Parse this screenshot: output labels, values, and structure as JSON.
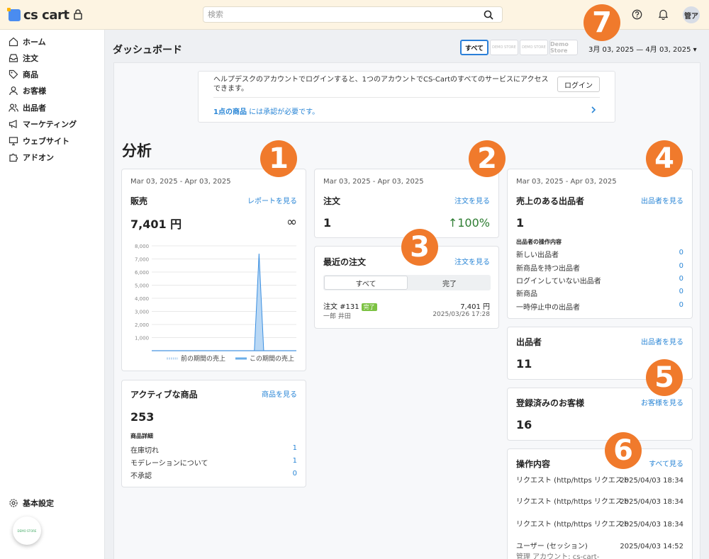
{
  "topbar": {
    "logo_text": "cs cart",
    "search_placeholder": "検索",
    "avatar": "管ア"
  },
  "sidebar": {
    "items": [
      {
        "label": "ホーム",
        "icon": "home-icon"
      },
      {
        "label": "注文",
        "icon": "inbox-icon"
      },
      {
        "label": "商品",
        "icon": "tag-icon"
      },
      {
        "label": "お客様",
        "icon": "user-icon"
      },
      {
        "label": "出品者",
        "icon": "users-icon"
      },
      {
        "label": "マーケティング",
        "icon": "megaphone-icon"
      },
      {
        "label": "ウェブサイト",
        "icon": "monitor-icon"
      },
      {
        "label": "アドオン",
        "icon": "puzzle-icon"
      }
    ],
    "settings_label": "基本設定",
    "store_bubble": "DEMO STORE"
  },
  "header": {
    "title": "ダッシュボード",
    "storefronts": [
      "すべて",
      "DEMO STORE",
      "DEMO STORE",
      "Demo Store"
    ],
    "date_range": "3月 03, 2025 — 4月 03, 2025 ▾"
  },
  "notice": {
    "text": "ヘルプデスクのアカウントでログインすると、1つのアカウントでCS-Cartのすべてのサービスにアクセスできます。",
    "login_button": "ログイン",
    "link_bold": "1点の商品",
    "link_rest": " には承認が必要です。"
  },
  "analytics": {
    "section_title": "分析",
    "sales": {
      "date": "Mar 03, 2025 - Apr 03, 2025",
      "title": "販売",
      "link": "レポートを見る",
      "value": "7,401 円",
      "change": "∞",
      "legend_prev": "前の期間の売上",
      "legend_curr": "この期間の売上"
    },
    "orders": {
      "date": "Mar 03, 2025 - Apr 03, 2025",
      "title": "注文",
      "link": "注文を見る",
      "value": "1",
      "change": "↑100%"
    },
    "recent_orders": {
      "title": "最近の注文",
      "link": "注文を見る",
      "tabs": [
        "すべて",
        "完了"
      ],
      "order_id": "注文 #131",
      "order_status": "完了",
      "order_total": "7,401 円",
      "customer": "一郎 井田",
      "order_date": "2025/03/26 17:28"
    },
    "active_products": {
      "title": "アクティブな商品",
      "link": "商品を見る",
      "value": "253",
      "detail_title": "商品詳細",
      "rows": [
        {
          "label": "在庫切れ",
          "value": "1"
        },
        {
          "label": "モデレーションについて",
          "value": "1"
        },
        {
          "label": "不承認",
          "value": "0"
        }
      ]
    },
    "vendors_sales": {
      "date": "Mar 03, 2025 - Apr 03, 2025",
      "title": "売上のある出品者",
      "link": "出品者を見る",
      "value": "1",
      "detail_title": "出品者の操作内容",
      "rows": [
        {
          "label": "新しい出品者",
          "value": "0"
        },
        {
          "label": "新商品を持つ出品者",
          "value": "0"
        },
        {
          "label": "ログインしていない出品者",
          "value": "0"
        },
        {
          "label": "新商品",
          "value": "0"
        },
        {
          "label": "一時停止中の出品者",
          "value": "0"
        }
      ]
    },
    "vendors": {
      "title": "出品者",
      "link": "出品者を見る",
      "value": "11"
    },
    "customers": {
      "title": "登録済みのお客様",
      "link": "お客様を見る",
      "value": "16"
    },
    "activity": {
      "title": "操作内容",
      "link": "すべて見る",
      "rows": [
        {
          "label": "リクエスト (http/https リクエスト",
          "time": "2025/04/03 18:34"
        },
        {
          "label": "リクエスト (http/https リクエスト",
          "time": "2025/04/03 18:34"
        },
        {
          "label": "リクエスト (http/https リクエスト",
          "time": "2025/04/03 18:34"
        },
        {
          "label": "ユーザー (セッション)",
          "time": "2025/04/03 14:52"
        }
      ],
      "last_sub": "管理 アカウント: cs-cart-"
    }
  },
  "markers": [
    "1",
    "2",
    "3",
    "4",
    "5",
    "6",
    "7"
  ],
  "colors": {
    "accent": "#2a86d6",
    "marker": "#f07a2c",
    "topbar": "#fdf4e2",
    "success": "#7cc243"
  },
  "chart_data": {
    "type": "area",
    "y_ticks": [
      "1,000",
      "2,000",
      "3,000",
      "4,000",
      "5,000",
      "6,000",
      "7,000",
      "8,000"
    ],
    "ylim": [
      0,
      8000
    ],
    "series": [
      {
        "name": "前の期間の売上",
        "values": [
          0,
          0,
          0,
          0,
          0,
          0,
          0,
          0,
          0,
          0,
          0,
          0,
          0,
          0,
          0,
          0,
          0,
          0,
          0,
          0,
          0,
          0,
          0,
          0,
          0,
          0,
          0,
          0,
          0,
          0,
          0,
          0
        ]
      },
      {
        "name": "この期間の売上",
        "values": [
          0,
          0,
          0,
          0,
          0,
          0,
          0,
          0,
          0,
          0,
          0,
          0,
          0,
          0,
          0,
          0,
          0,
          0,
          0,
          0,
          0,
          0,
          0,
          7401,
          0,
          0,
          0,
          0,
          0,
          0,
          0,
          0
        ]
      }
    ]
  }
}
